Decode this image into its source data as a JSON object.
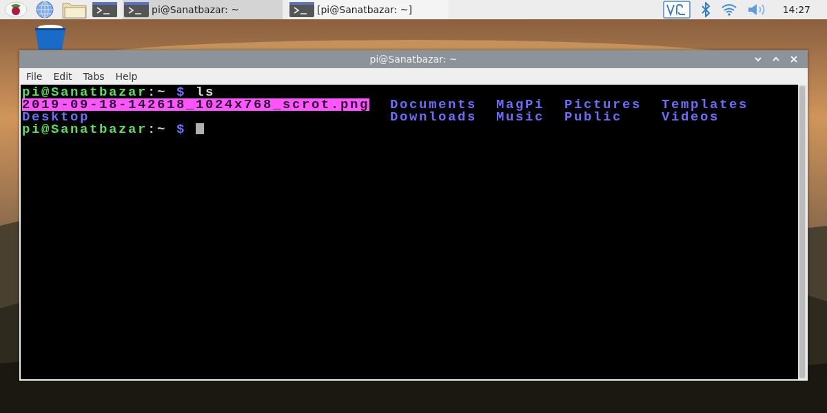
{
  "taskbar": {
    "tasks": [
      {
        "title": "pi@Sanatbazar: ~",
        "selected": true
      },
      {
        "title": "[pi@Sanatbazar: ~]",
        "selected": false
      }
    ],
    "clock": "14:27"
  },
  "window": {
    "title": "pi@Sanatbazar: ~",
    "menu": [
      "File",
      "Edit",
      "Tabs",
      "Help"
    ],
    "terminal": [
      {
        "kind": "prompt",
        "user": "pi@Sanatbazar",
        "path": ":~",
        "symbol": "$",
        "command": "ls",
        "cursor": false
      },
      {
        "kind": "listing",
        "rows": [
          [
            {
              "text": "2019-09-18-142618_1024x768_scrot.png",
              "kind": "highlight"
            },
            {
              "text": "Documents",
              "kind": "dir"
            },
            {
              "text": "MagPi",
              "kind": "dir"
            },
            {
              "text": "Pictures",
              "kind": "dir"
            },
            {
              "text": "Templates",
              "kind": "dir"
            }
          ],
          [
            {
              "text": "Desktop",
              "kind": "dir"
            },
            {
              "text": "Downloads",
              "kind": "dir"
            },
            {
              "text": "Music",
              "kind": "dir"
            },
            {
              "text": "Public",
              "kind": "dir"
            },
            {
              "text": "Videos",
              "kind": "dir"
            }
          ]
        ]
      },
      {
        "kind": "prompt",
        "user": "pi@Sanatbazar",
        "path": ":~",
        "symbol": "$",
        "cursor": true
      }
    ]
  }
}
